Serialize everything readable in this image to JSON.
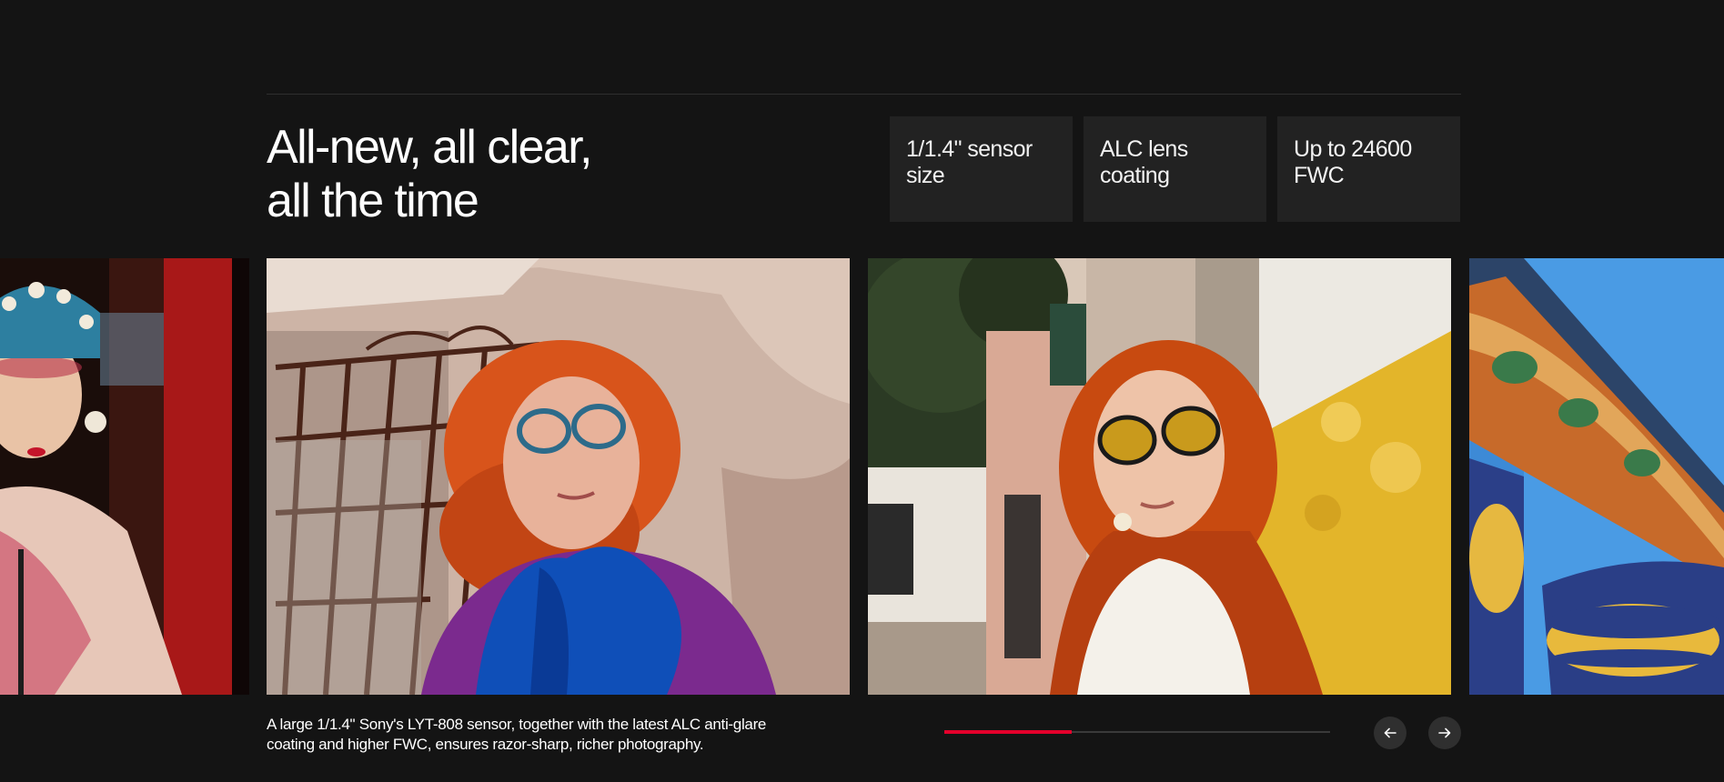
{
  "section": {
    "headline_line1": "All-new, all clear,",
    "headline_line2": "all the time"
  },
  "specs": [
    {
      "label": "1/1.4\" sensor size"
    },
    {
      "label": "ALC lens coating"
    },
    {
      "label": "Up to 24600 FWC"
    }
  ],
  "gallery": {
    "photos": [
      {
        "subject": "opera performer in headdress"
      },
      {
        "subject": "red-haired woman with blue scarf"
      },
      {
        "subject": "woman with sunglasses on sunny street"
      },
      {
        "subject": "ornate tiled architecture against blue sky"
      }
    ],
    "caption": "A large 1/1.4\" Sony's LYT-808 sensor, together with the latest ALC anti-glare coating and higher FWC, ensures razor-sharp, richer photography.",
    "progress": 0.33,
    "prev_icon": "arrow-left-icon",
    "next_icon": "arrow-right-icon"
  },
  "colors": {
    "background": "#141414",
    "card": "#222222",
    "accent": "#e4002b"
  }
}
